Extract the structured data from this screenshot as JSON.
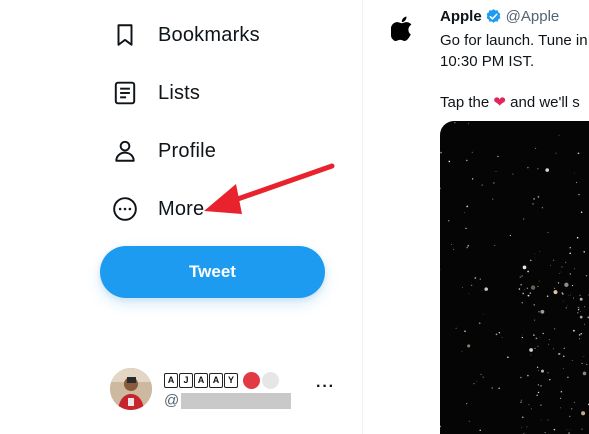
{
  "sidebar": {
    "items": [
      {
        "label": "Bookmarks",
        "icon": "bookmark-icon"
      },
      {
        "label": "Lists",
        "icon": "lists-icon"
      },
      {
        "label": "Profile",
        "icon": "profile-icon"
      },
      {
        "label": "More",
        "icon": "more-circle-icon"
      }
    ],
    "tweet_button": "Tweet"
  },
  "account": {
    "display_name_letters": [
      "A",
      "J",
      "A",
      "A",
      "Y"
    ],
    "handle_prefix": "@",
    "more_label": "···"
  },
  "tweet": {
    "author_name": "Apple",
    "author_handle": "@Apple",
    "line1": "Go for launch. Tune in",
    "line2": "10:30 PM IST.",
    "line3_prefix": "Tap the",
    "line3_heart": "❤",
    "line3_suffix": " and we'll s"
  },
  "colors": {
    "accent": "#1d9bf0",
    "annotation_arrow": "#e8232e",
    "heart": "#e0245e"
  }
}
